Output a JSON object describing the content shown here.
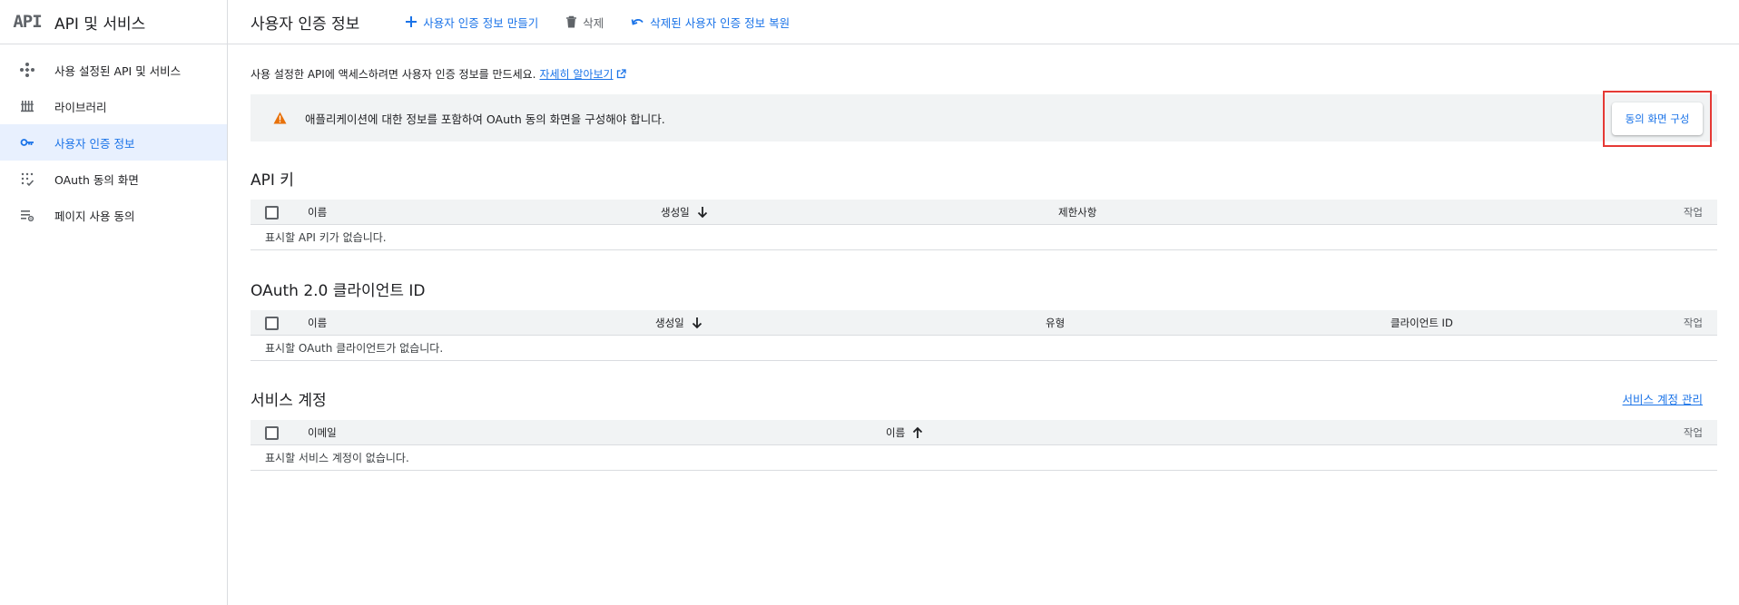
{
  "sidebar": {
    "logo": "API",
    "title": "API 및 서비스",
    "items": [
      {
        "label": "사용 설정된 API 및 서비스",
        "icon": "api-hub-icon",
        "active": false
      },
      {
        "label": "라이브러리",
        "icon": "library-icon",
        "active": false
      },
      {
        "label": "사용자 인증 정보",
        "icon": "key-icon",
        "active": true
      },
      {
        "label": "OAuth 동의 화면",
        "icon": "consent-grid-icon",
        "active": false
      },
      {
        "label": "페이지 사용 동의",
        "icon": "settings-list-icon",
        "active": false
      }
    ]
  },
  "topbar": {
    "title": "사용자 인증 정보",
    "create_label": "사용자 인증 정보 만들기",
    "delete_label": "삭제",
    "restore_label": "삭제된 사용자 인증 정보 복원"
  },
  "intro": {
    "text": "사용 설정한 API에 액세스하려면 사용자 인증 정보를 만드세요.",
    "link": "자세히 알아보기"
  },
  "banner": {
    "text": "애플리케이션에 대한 정보를 포함하여 OAuth 동의 화면을 구성해야 합니다.",
    "button": "동의 화면 구성"
  },
  "api_keys": {
    "title": "API 키",
    "columns": {
      "name": "이름",
      "created": "생성일",
      "restrictions": "제한사항",
      "actions": "작업"
    },
    "empty": "표시할 API 키가 없습니다."
  },
  "oauth": {
    "title": "OAuth 2.0 클라이언트 ID",
    "columns": {
      "name": "이름",
      "created": "생성일",
      "type": "유형",
      "client_id": "클라이언트 ID",
      "actions": "작업"
    },
    "empty": "표시할 OAuth 클라이언트가 없습니다."
  },
  "service_accounts": {
    "title": "서비스 계정",
    "manage_link": "서비스 계정 관리",
    "columns": {
      "email": "이메일",
      "name": "이름",
      "actions": "작업"
    },
    "empty": "표시할 서비스 계정이 없습니다."
  },
  "colors": {
    "accent": "#1a73e8",
    "warning": "#e8710a",
    "highlight": "#e53935",
    "active_bg": "#e8f0fe"
  }
}
